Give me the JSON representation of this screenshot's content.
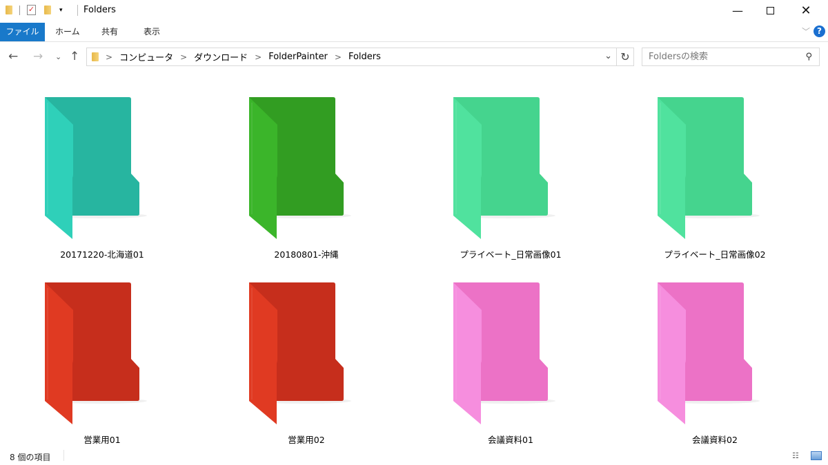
{
  "window": {
    "title": "Folders",
    "minimize_icon": "minimize-icon",
    "maximize_icon": "maximize-icon",
    "close_icon": "close-icon"
  },
  "ribbon": {
    "tabs": [
      "ファイル",
      "ホーム",
      "共有",
      "表示"
    ],
    "help": "?"
  },
  "address": {
    "crumbs": [
      "コンピュータ",
      "ダウンロード",
      "FolderPainter",
      "Folders"
    ]
  },
  "search": {
    "placeholder": "Foldersの検索"
  },
  "folders": [
    {
      "name": "20171220-北海道01",
      "back": "#27b5a0",
      "front": "#2fd0b9"
    },
    {
      "name": "20180801-沖縄",
      "back": "#329d22",
      "front": "#3bb52a"
    },
    {
      "name": "プライベート_日常画像01",
      "back": "#45d48e",
      "front": "#50e29e"
    },
    {
      "name": "プライベート_日常画像02",
      "back": "#45d48e",
      "front": "#50e29e"
    },
    {
      "name": "営業用01",
      "back": "#c62e1c",
      "front": "#e03a22"
    },
    {
      "name": "営業用02",
      "back": "#c62e1c",
      "front": "#e03a22"
    },
    {
      "name": "会議資料01",
      "back": "#ec72c6",
      "front": "#f68ede"
    },
    {
      "name": "会議資料02",
      "back": "#ec72c6",
      "front": "#f68ede"
    }
  ],
  "status": {
    "count": "8 個の項目"
  }
}
